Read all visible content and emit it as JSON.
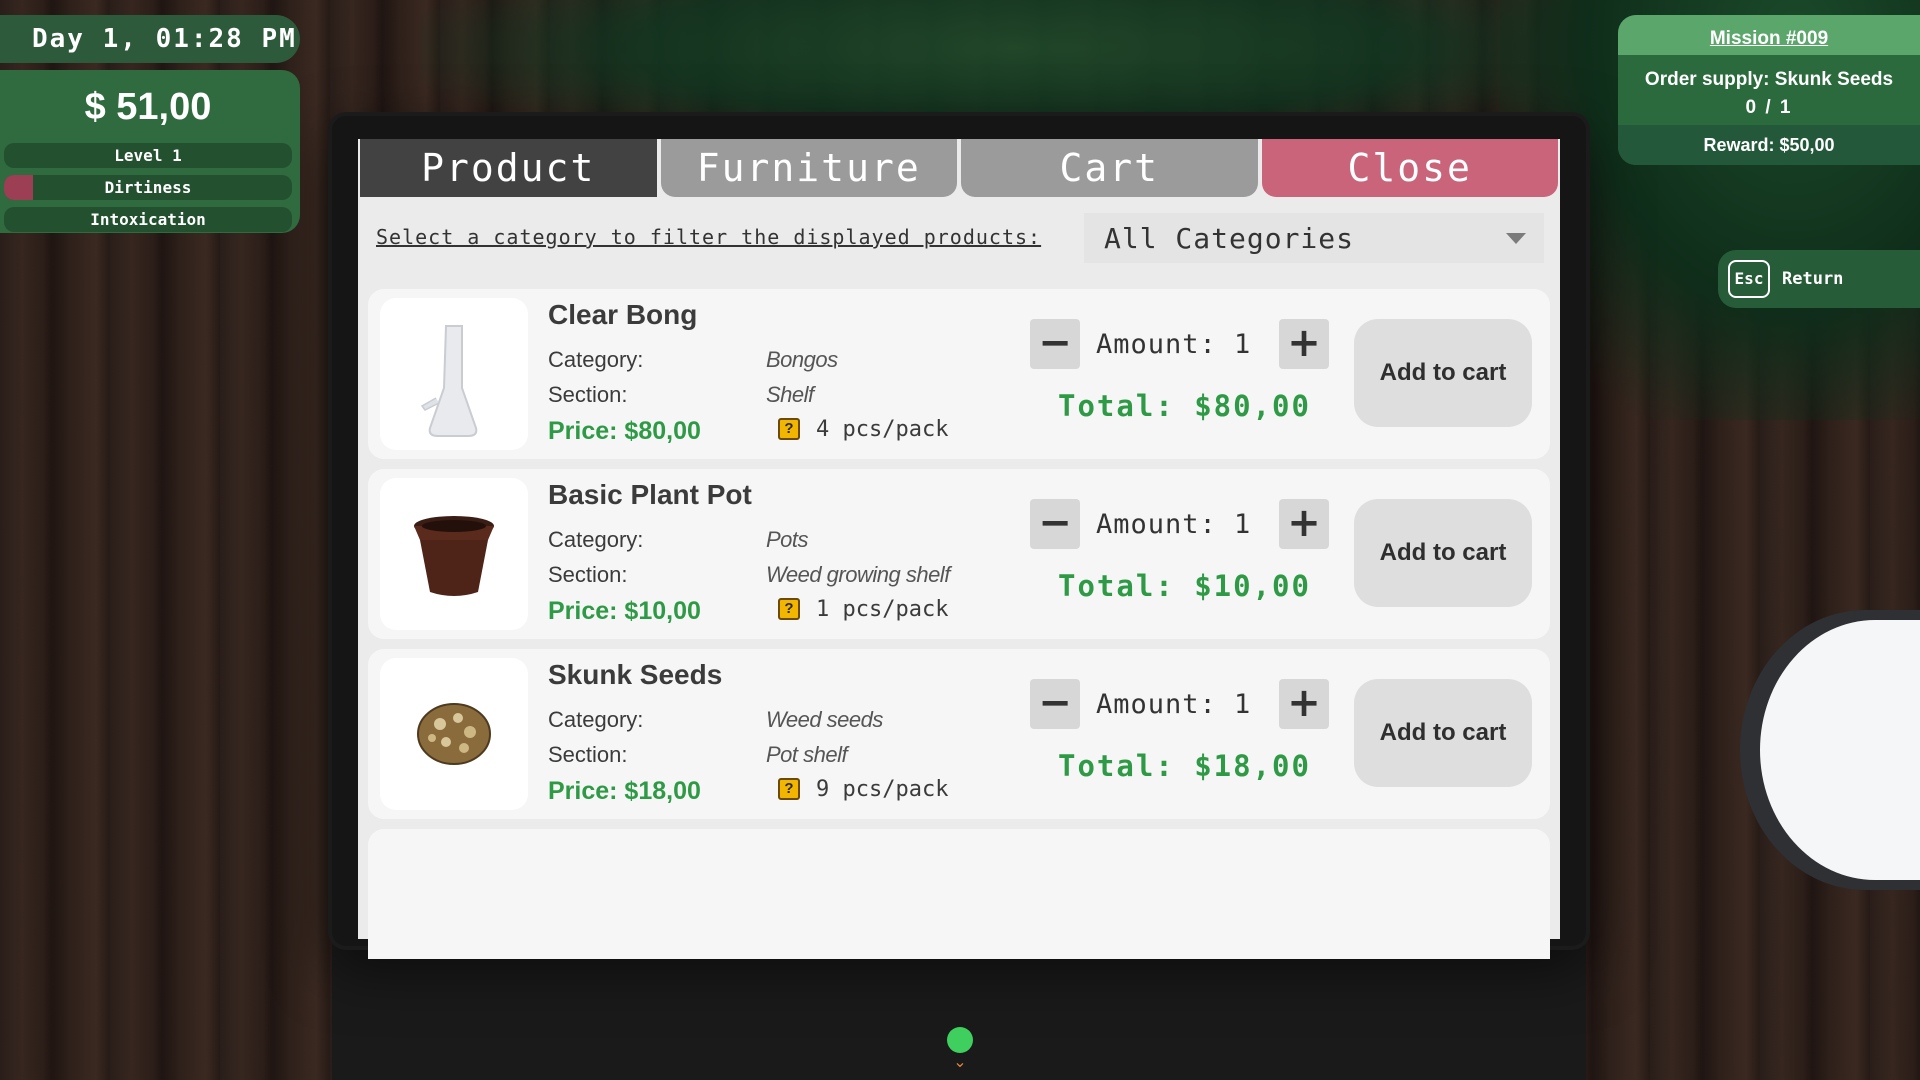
{
  "hud": {
    "time": "Day 1, 01:28 PM",
    "money": "$ 51,00",
    "level": "Level 1",
    "dirtiness": "Dirtiness",
    "dirtiness_level": 0.1,
    "intoxication": "Intoxication"
  },
  "mission": {
    "title": "Mission #009",
    "description": "Order supply: Skunk Seeds",
    "progress": "0 / 1",
    "reward": "Reward: $50,00"
  },
  "return": {
    "key": "Esc",
    "label": "Return"
  },
  "tabs": {
    "product": "Product",
    "furniture": "Furniture",
    "cart": "Cart",
    "close": "Close"
  },
  "filter": {
    "label": "Select a category to filter the displayed products:",
    "selected": "All Categories"
  },
  "labels": {
    "category": "Category:",
    "section": "Section:",
    "help": "?",
    "minus": "−",
    "plus": "+",
    "add_to_cart": "Add to cart"
  },
  "products": [
    {
      "name": "Clear Bong",
      "category": "Bongos",
      "section": "Shelf",
      "price": "Price: $80,00",
      "pack": "4 pcs/pack",
      "amount": "Amount: 1",
      "total": "Total: $80,00",
      "icon": "bong-icon"
    },
    {
      "name": "Basic Plant Pot",
      "category": "Pots",
      "section": "Weed growing shelf",
      "price": "Price: $10,00",
      "pack": "1 pcs/pack",
      "amount": "Amount: 1",
      "total": "Total: $10,00",
      "icon": "plant-pot-icon"
    },
    {
      "name": "Skunk Seeds",
      "category": "Weed seeds",
      "section": "Pot shelf",
      "price": "Price: $18,00",
      "pack": "9 pcs/pack",
      "amount": "Amount: 1",
      "total": "Total: $18,00",
      "icon": "seed-icon"
    }
  ],
  "colors": {
    "hud_green": "#2f6b3f",
    "price_green": "#2f9a46",
    "close_tab": "#c9647a",
    "active_tab": "#424242"
  }
}
